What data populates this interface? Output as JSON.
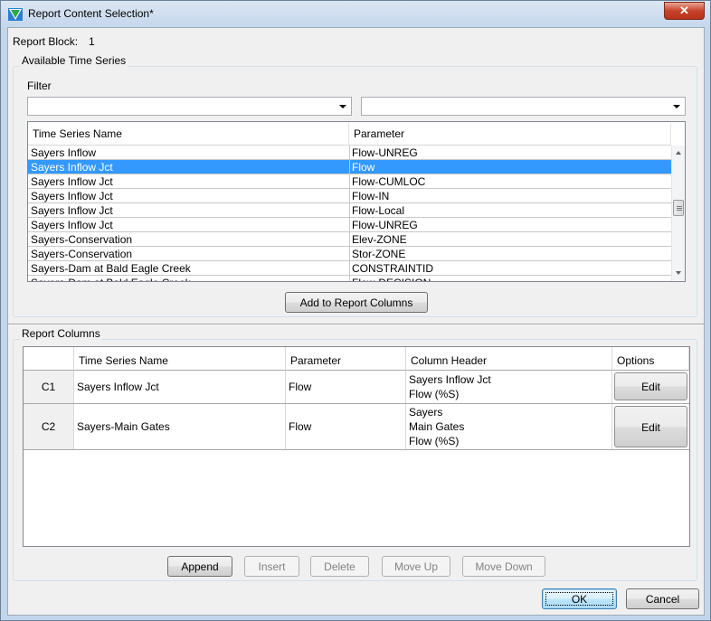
{
  "window": {
    "title": "Report Content Selection*",
    "close_label": "✕"
  },
  "report_block": {
    "label": "Report Block:",
    "value": "1"
  },
  "available": {
    "group_title": "Available Time Series",
    "filter_label": "Filter",
    "filter1_value": "",
    "filter2_value": "",
    "columns": [
      "Time Series Name",
      "Parameter"
    ],
    "rows": [
      {
        "name": "Sayers Inflow",
        "param": "Flow-UNREG"
      },
      {
        "name": "Sayers Inflow Jct",
        "param": "Flow"
      },
      {
        "name": "Sayers Inflow Jct",
        "param": "Flow-CUMLOC"
      },
      {
        "name": "Sayers Inflow Jct",
        "param": "Flow-IN"
      },
      {
        "name": "Sayers Inflow Jct",
        "param": "Flow-Local"
      },
      {
        "name": "Sayers Inflow Jct",
        "param": "Flow-UNREG"
      },
      {
        "name": "Sayers-Conservation",
        "param": "Elev-ZONE"
      },
      {
        "name": "Sayers-Conservation",
        "param": "Stor-ZONE"
      },
      {
        "name": "Sayers-Dam at Bald Eagle Creek",
        "param": "CONSTRAINTID"
      },
      {
        "name": "Sayers-Dam at Bald Eagle Creek",
        "param": "Flow-DECISION"
      }
    ],
    "selected_index": 1,
    "add_button": "Add to Report Columns"
  },
  "report_columns": {
    "group_title": "Report Columns",
    "columns": [
      "",
      "Time Series Name",
      "Parameter",
      "Column Header",
      "Options"
    ],
    "rows": [
      {
        "id": "C1",
        "name": "Sayers Inflow Jct",
        "param": "Flow",
        "header": [
          "Sayers Inflow Jct",
          "Flow (%S)"
        ],
        "option": "Edit"
      },
      {
        "id": "C2",
        "name": "Sayers-Main Gates",
        "param": "Flow",
        "header": [
          "Sayers",
          "Main Gates",
          "Flow (%S)"
        ],
        "option": "Edit"
      }
    ],
    "buttons": {
      "append": "Append",
      "insert": "Insert",
      "delete": "Delete",
      "move_up": "Move Up",
      "move_down": "Move Down"
    }
  },
  "footer": {
    "ok": "OK",
    "cancel": "Cancel"
  }
}
